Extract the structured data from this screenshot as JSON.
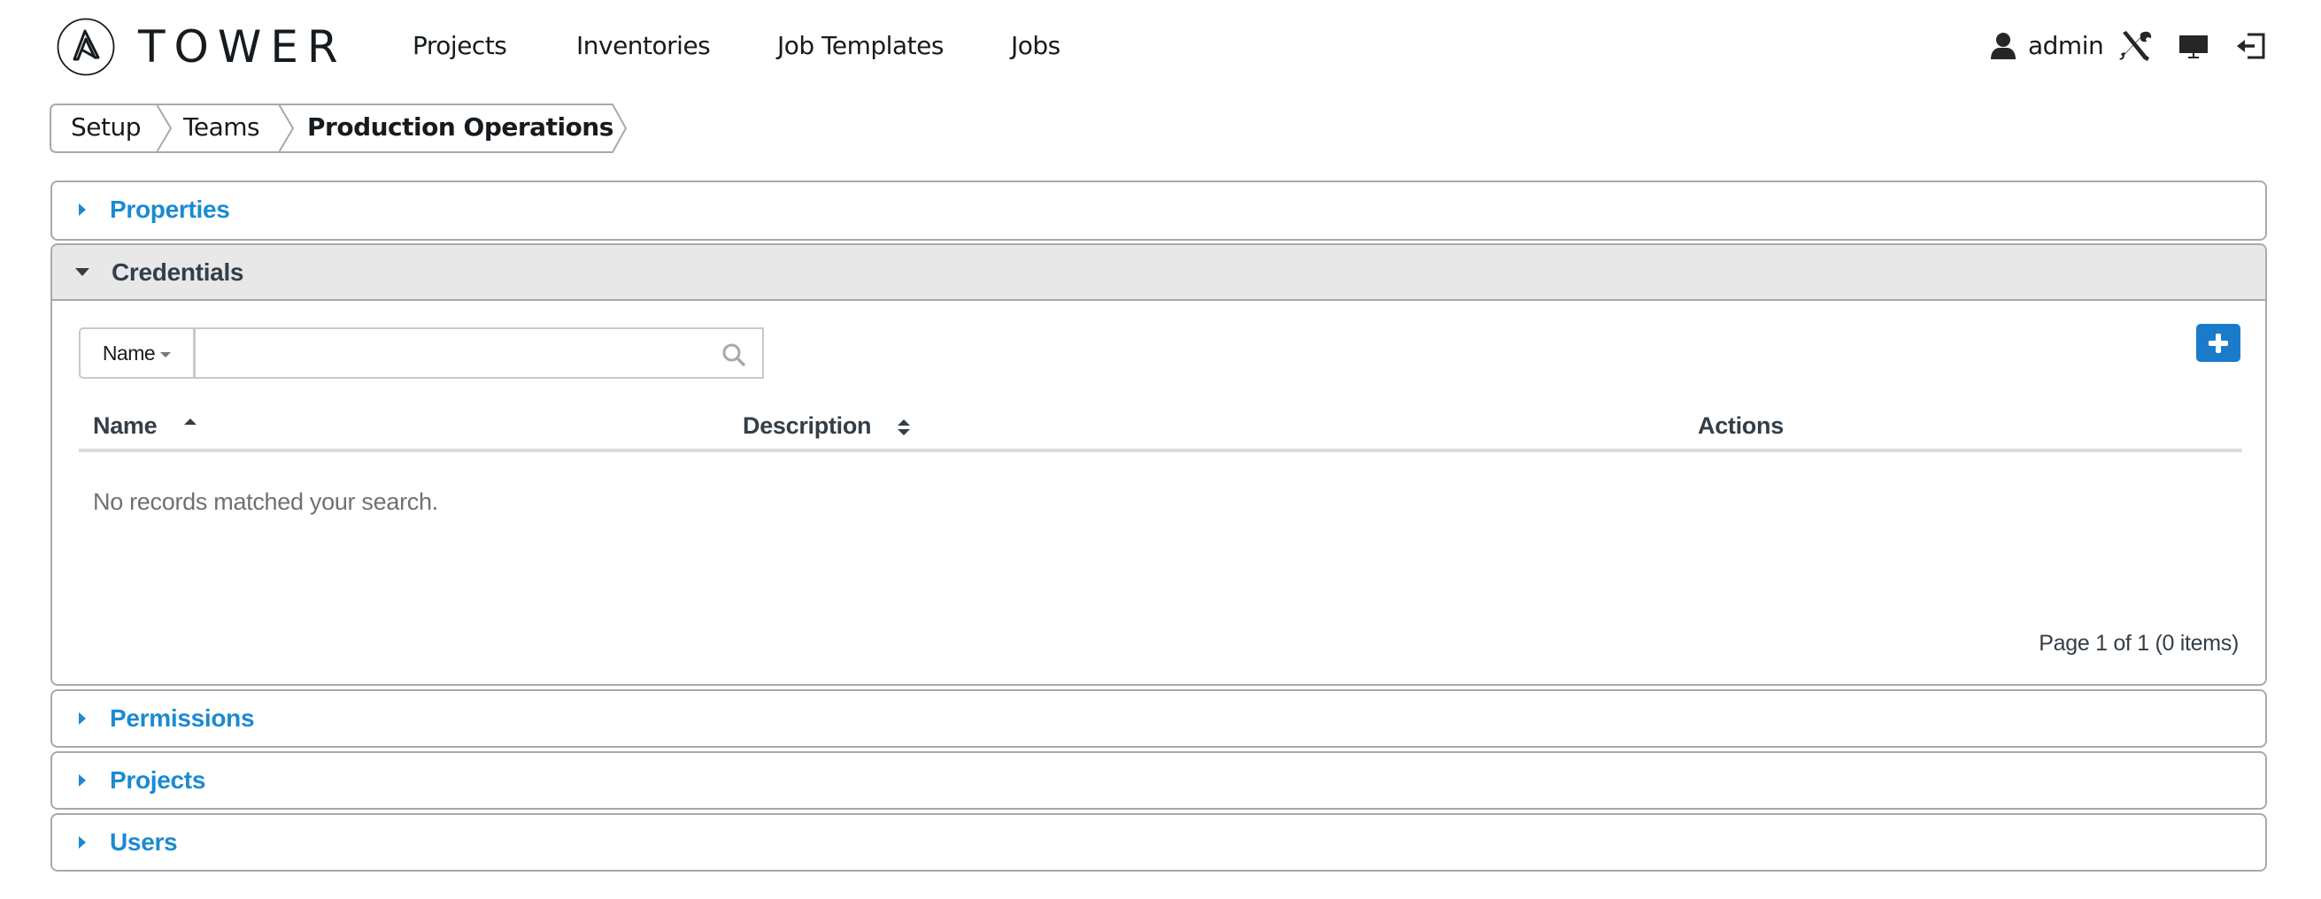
{
  "app": {
    "brand": "TOWER"
  },
  "nav": {
    "items": [
      {
        "label": "Projects"
      },
      {
        "label": "Inventories"
      },
      {
        "label": "Job Templates"
      },
      {
        "label": "Jobs"
      }
    ],
    "user": {
      "name": "admin",
      "icons": [
        "user-icon",
        "setup-tools-icon",
        "monitor-icon",
        "logout-icon"
      ]
    }
  },
  "breadcrumb": {
    "items": [
      {
        "label": "Setup"
      },
      {
        "label": "Teams"
      },
      {
        "label": "Production Operations"
      }
    ]
  },
  "panels": {
    "properties": {
      "title": "Properties",
      "expanded": false
    },
    "credentials": {
      "title": "Credentials",
      "expanded": true,
      "search": {
        "field_label": "Name",
        "value": "",
        "placeholder": ""
      },
      "add_button_icon": "plus-icon",
      "table": {
        "columns": [
          {
            "label": "Name",
            "sort": "ascending"
          },
          {
            "label": "Description",
            "sort": "sortable"
          },
          {
            "label": "Actions",
            "sort": "none"
          }
        ],
        "rows": [],
        "empty_message": "No records matched your search."
      },
      "pagination": "Page 1 of 1 (0 items)"
    },
    "permissions": {
      "title": "Permissions",
      "expanded": false
    },
    "projects": {
      "title": "Projects",
      "expanded": false
    },
    "users": {
      "title": "Users",
      "expanded": false
    }
  },
  "colors": {
    "accent": "#1b8ad1",
    "button_primary": "#1b7bcb",
    "header_text": "#333e48",
    "panel_border": "#a9a9a9",
    "open_header_bg": "#e8e8e8",
    "muted_text": "#707070"
  }
}
